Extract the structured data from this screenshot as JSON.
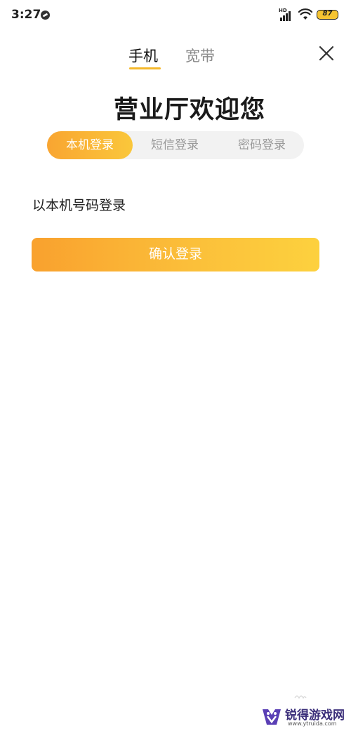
{
  "status_bar": {
    "time": "3:27",
    "hd_label": "HD",
    "battery": "87",
    "battery_color": "#f6c431"
  },
  "top_tabs": {
    "items": [
      {
        "label": "手机",
        "active": true
      },
      {
        "label": "宽带",
        "active": false
      }
    ],
    "close_icon": "close-icon"
  },
  "title": "营业厅欢迎您",
  "login_methods": {
    "options": [
      "本机登录",
      "短信登录",
      "密码登录"
    ],
    "selected": "本机登录"
  },
  "description": "以本机号码登录",
  "confirm_button": "确认登录",
  "watermark": {
    "text": "锐得游戏网",
    "url": "www.ytruida.com"
  },
  "colors": {
    "accent": "#f9a531",
    "accent_light": "#fdd13e",
    "inactive_text": "#9a9a9a"
  }
}
